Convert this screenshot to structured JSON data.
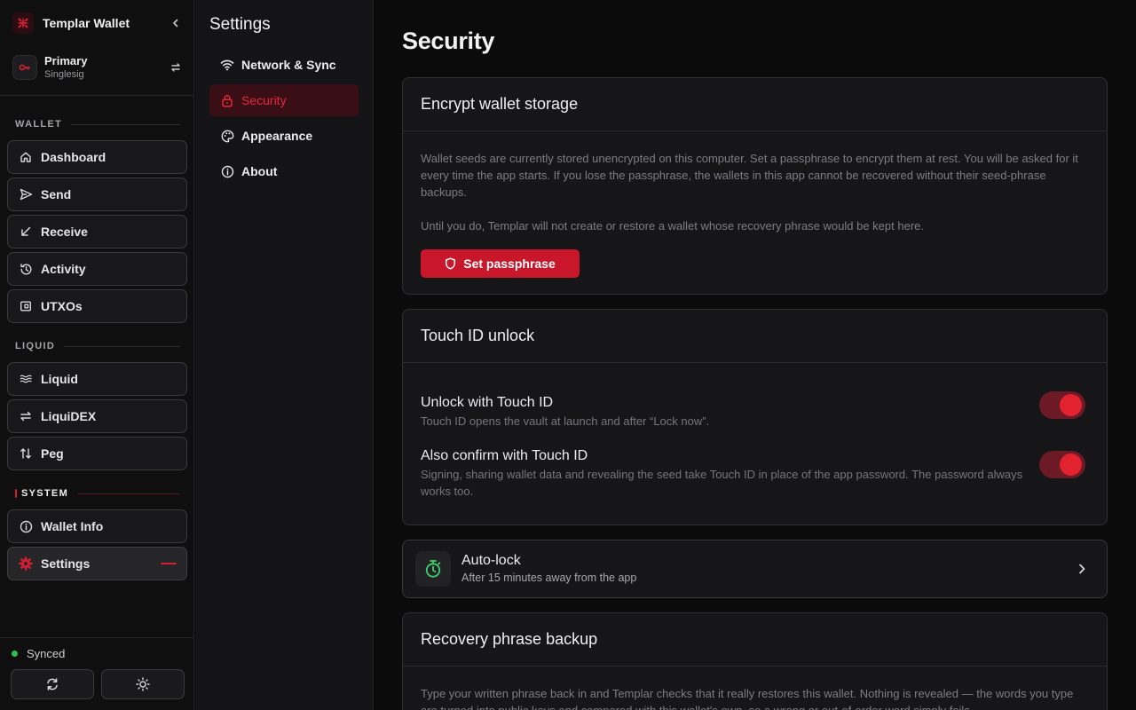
{
  "app": {
    "name": "Templar Wallet",
    "account_name": "Primary",
    "account_type": "Singlesig"
  },
  "sidebar": {
    "sections": [
      {
        "label": "WALLET"
      },
      {
        "label": "LIQUID"
      },
      {
        "label": "SYSTEM"
      }
    ],
    "items": [
      {
        "label": "Dashboard",
        "icon": "home-icon"
      },
      {
        "label": "Send",
        "icon": "send-icon"
      },
      {
        "label": "Receive",
        "icon": "receive-arrow-icon"
      },
      {
        "label": "Activity",
        "icon": "history-icon"
      },
      {
        "label": "UTXOs",
        "icon": "wallet-icon"
      },
      {
        "label": "Liquid",
        "icon": "waves-icon"
      },
      {
        "label": "LiquiDEX",
        "icon": "swap-icon"
      },
      {
        "label": "Peg",
        "icon": "peg-icon"
      },
      {
        "label": "Wallet Info",
        "icon": "info-icon"
      },
      {
        "label": "Settings",
        "icon": "gear-icon",
        "active": true
      }
    ],
    "status": "Synced"
  },
  "settings_nav": {
    "title": "Settings",
    "items": [
      {
        "label": "Network & Sync",
        "icon": "wifi-icon"
      },
      {
        "label": "Security",
        "icon": "lock-icon",
        "active": true
      },
      {
        "label": "Appearance",
        "icon": "palette-icon"
      },
      {
        "label": "About",
        "icon": "info-icon"
      }
    ]
  },
  "main": {
    "title": "Security",
    "encrypt": {
      "title": "Encrypt wallet storage",
      "para1": "Wallet seeds are currently stored unencrypted on this computer. Set a passphrase to encrypt them at rest. You will be asked for it every time the app starts. If you lose the passphrase, the wallets in this app cannot be recovered without their seed-phrase backups.",
      "para2": "Until you do, Templar will not create or restore a wallet whose recovery phrase would be kept here.",
      "button": "Set passphrase"
    },
    "touchid": {
      "title": "Touch ID unlock",
      "unlock_title": "Unlock with Touch ID",
      "unlock_desc": "Touch ID opens the vault at launch and after “Lock now”.",
      "unlock_on": true,
      "confirm_title": "Also confirm with Touch ID",
      "confirm_desc": "Signing, sharing wallet data and revealing the seed take Touch ID in place of the app password. The password always works too.",
      "confirm_on": true
    },
    "autolock": {
      "title": "Auto-lock",
      "desc": "After 15 minutes away from the app"
    },
    "recovery": {
      "title": "Recovery phrase backup",
      "para": "Type your written phrase back in and Templar checks that it really restores this wallet. Nothing is revealed — the words you type are turned into public keys and compared with this wallet's own, so a wrong or out-of-order word simply fails."
    }
  },
  "colors": {
    "accent": "#c8162a",
    "accent_text": "#e5283d",
    "synced": "#2fbf4f",
    "timer_icon": "#3ecf6e"
  }
}
